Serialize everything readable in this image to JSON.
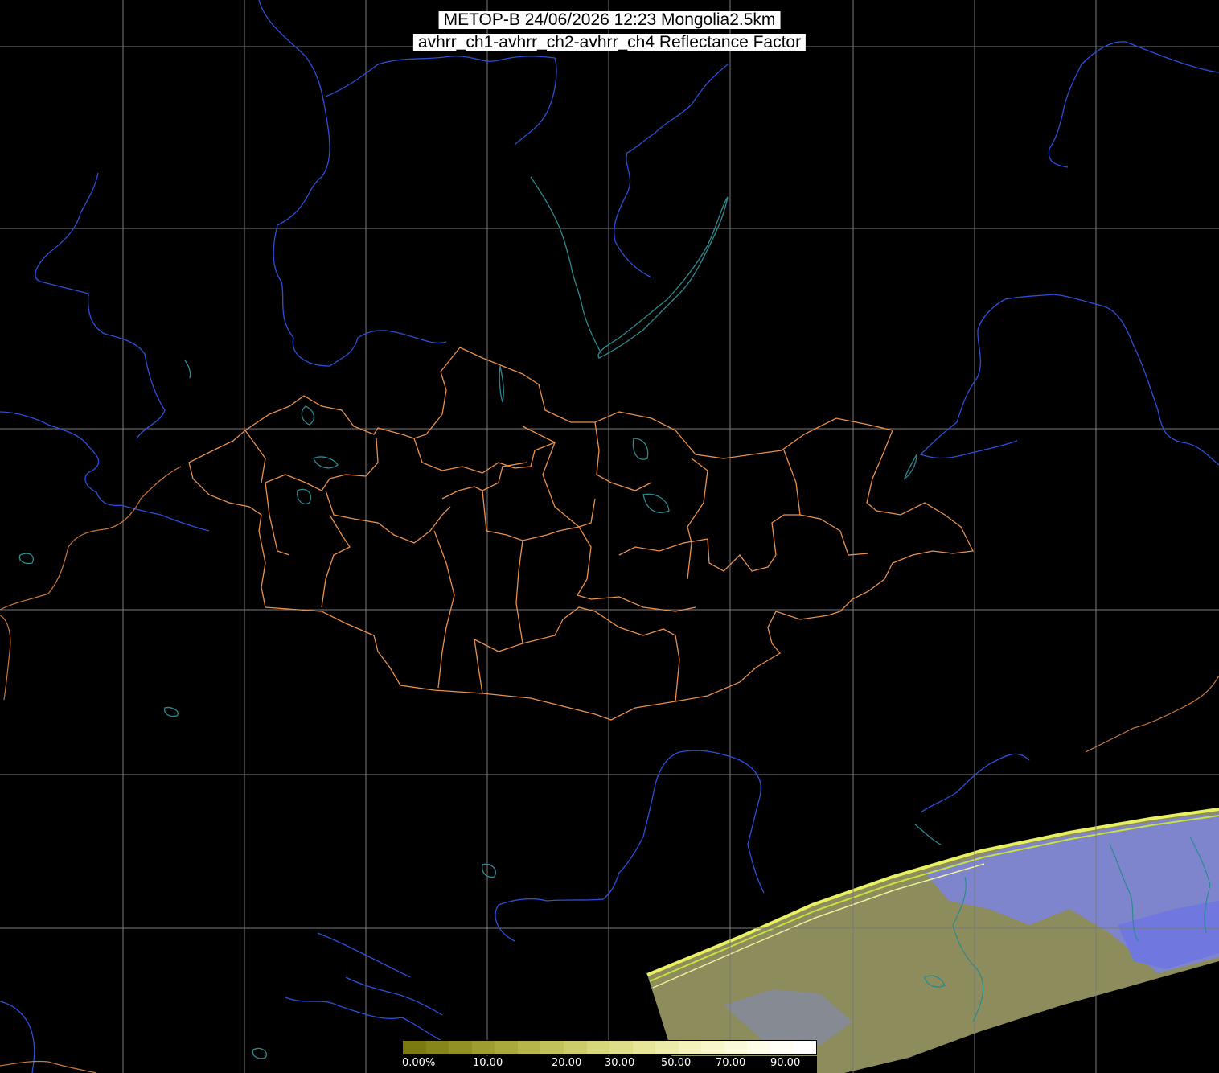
{
  "title": {
    "line1": "METOP-B 24/06/2026 12:23 Mongolia2.5km",
    "line2": "avhrr_ch1-avhrr_ch2-avhrr_ch4 Reflectance Factor"
  },
  "legend": {
    "labels": [
      "0.00%",
      "10.00",
      "20.00",
      "30.00",
      "50.00",
      "70.00",
      "90.00"
    ],
    "colors": [
      "#7a7a10",
      "#86861a",
      "#929224",
      "#9e9e30",
      "#aaaa3c",
      "#b6b64a",
      "#c2c25a",
      "#cccc6a",
      "#d6d67a",
      "#dede8a",
      "#e6e69a",
      "#ececaa",
      "#f2f2ba",
      "#f6f6ca",
      "#fafada",
      "#fcfce8",
      "#fefef4",
      "#ffffff"
    ]
  },
  "colors": {
    "background": "#000000",
    "grid": "#808080",
    "coastline": "#2b4fd8",
    "lakes": "#2a8a90",
    "borders": "#e8904c",
    "swath_dark": "#8a8a5a",
    "swath_blue": "#7a82e0"
  }
}
